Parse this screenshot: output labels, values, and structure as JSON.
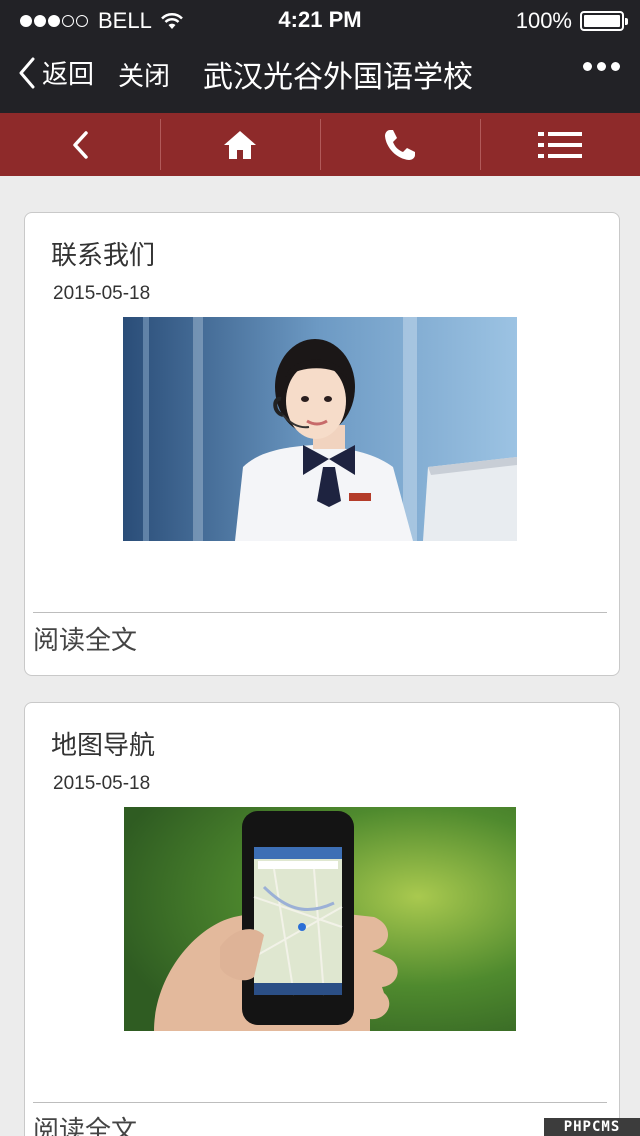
{
  "status_bar": {
    "carrier": "BELL",
    "time": "4:21 PM",
    "battery": "100%",
    "signal_bars_filled": 3,
    "signal_bars_total": 5
  },
  "title_bar": {
    "back_label": "返回",
    "close_label": "关闭",
    "title": "武汉光谷外国语学校"
  },
  "nav": {
    "items": [
      {
        "icon": "back-arrow-icon"
      },
      {
        "icon": "home-icon"
      },
      {
        "icon": "phone-icon"
      },
      {
        "icon": "menu-list-icon"
      }
    ],
    "color": "#8e2a2a"
  },
  "articles": [
    {
      "title": "联系我们",
      "date": "2015-05-18",
      "image": "customer-service-photo",
      "more": "阅读全文"
    },
    {
      "title": "地图导航",
      "date": "2015-05-18",
      "image": "phone-map-photo",
      "more": "阅读全文"
    }
  ],
  "watermark": "PHPCMS"
}
